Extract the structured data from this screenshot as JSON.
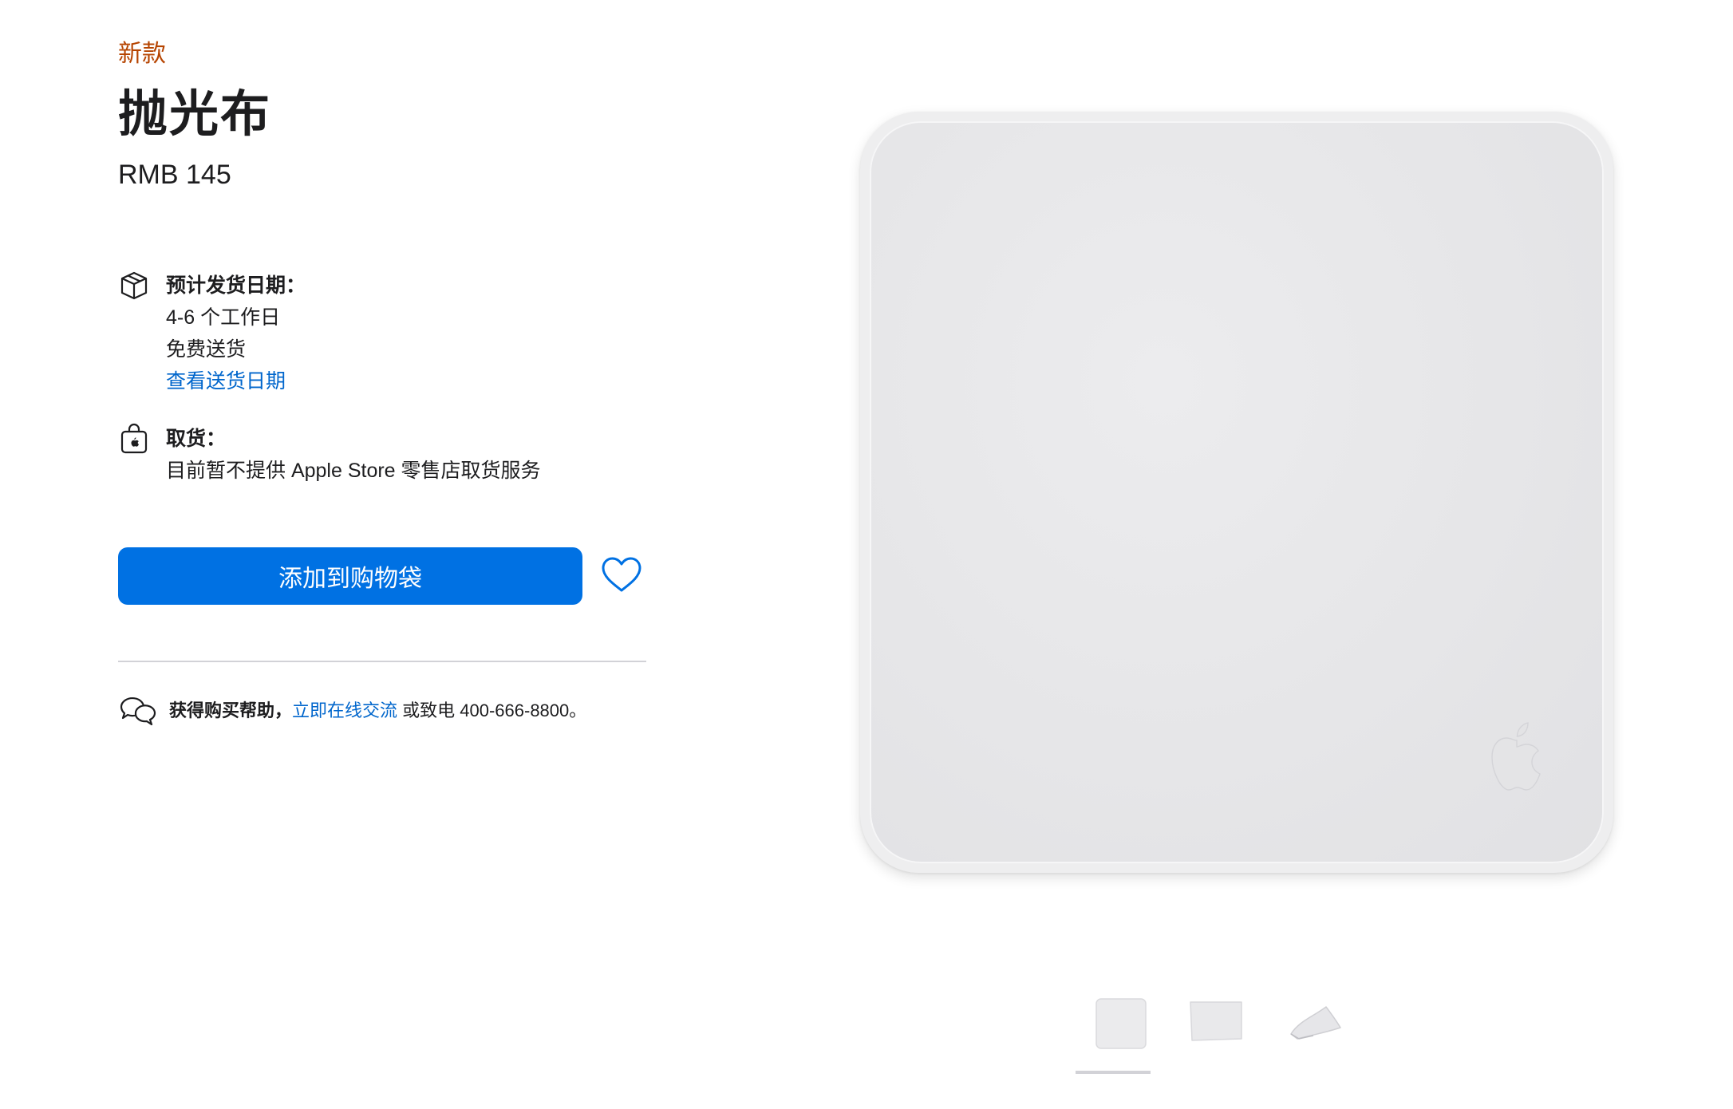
{
  "product": {
    "eyebrow": "新款",
    "title": "抛光布",
    "price": "RMB 145"
  },
  "shipping": {
    "label": "预计发货日期：",
    "eta": "4-6 个工作日",
    "free": "免费送货",
    "link": "查看送货日期",
    "icon": "box-icon"
  },
  "pickup": {
    "label": "取货：",
    "note": "目前暂不提供 Apple Store 零售店取货服务",
    "icon": "shopping-bag-icon"
  },
  "actions": {
    "add_to_bag": "添加到购物袋",
    "favorite_icon": "heart-icon",
    "accent": "#0071e3"
  },
  "help": {
    "lead": "获得购买帮助，",
    "chat_link": "立即在线交流",
    "phone_text": " 或致电 400-666-8800。",
    "icon": "chat-bubbles-icon"
  },
  "gallery": {
    "thumbnails": [
      "polishing-cloth-front",
      "polishing-cloth-angle",
      "polishing-cloth-folded"
    ],
    "selected_index": 0
  },
  "colors": {
    "eyebrow": "#b64400",
    "link": "#0066cc"
  }
}
